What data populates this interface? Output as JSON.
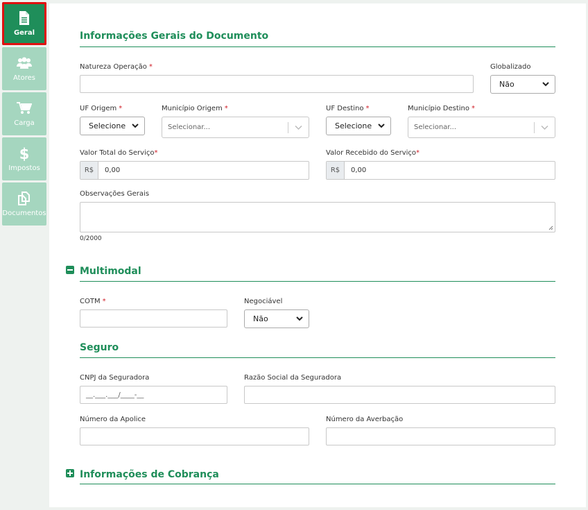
{
  "sidebar": {
    "items": [
      {
        "label": "Geral",
        "icon": "document-icon",
        "active": true
      },
      {
        "label": "Atores",
        "icon": "users-icon",
        "active": false
      },
      {
        "label": "Carga",
        "icon": "cart-icon",
        "active": false
      },
      {
        "label": "Impostos",
        "icon": "dollar-icon",
        "active": false
      },
      {
        "label": "Documentos",
        "icon": "documents-icon",
        "active": false
      }
    ]
  },
  "general": {
    "title": "Informações Gerais do Documento",
    "natureza_label": "Natureza Operação",
    "natureza_value": "",
    "globalizado_label": "Globalizado",
    "globalizado_value": "Não",
    "uf_origem_label": "UF Origem",
    "uf_origem_value": "Selecione",
    "municipio_origem_label": "Município Origem",
    "municipio_origem_placeholder": "Selecionar...",
    "uf_destino_label": "UF Destino",
    "uf_destino_value": "Selecione",
    "municipio_destino_label": "Município Destino",
    "municipio_destino_placeholder": "Selecionar...",
    "valor_total_label": "Valor Total do Serviço",
    "valor_total_prefix": "R$",
    "valor_total_value": "0,00",
    "valor_recebido_label": "Valor Recebido do Serviço",
    "valor_recebido_prefix": "R$",
    "valor_recebido_value": "0,00",
    "observacoes_label": "Observações Gerais",
    "observacoes_counter": "0/2000",
    "required_mark": "*"
  },
  "multimodal": {
    "title": "Multimodal",
    "cotm_label": "COTM",
    "negociavel_label": "Negociável",
    "negociavel_value": "Não"
  },
  "seguro": {
    "title": "Seguro",
    "cnpj_label": "CNPJ da Seguradora",
    "cnpj_mask": "__.___.___/____-__",
    "razao_label": "Razão Social da Seguradora",
    "apolice_label": "Número da Apolice",
    "averbacao_label": "Número da Averbação"
  },
  "cobranca": {
    "title": "Informações de Cobrança"
  },
  "colors": {
    "accent": "#1f8e5a",
    "sidebar_inactive": "#a5d6bf",
    "active_outline": "#e01010",
    "required": "#d0202a"
  }
}
